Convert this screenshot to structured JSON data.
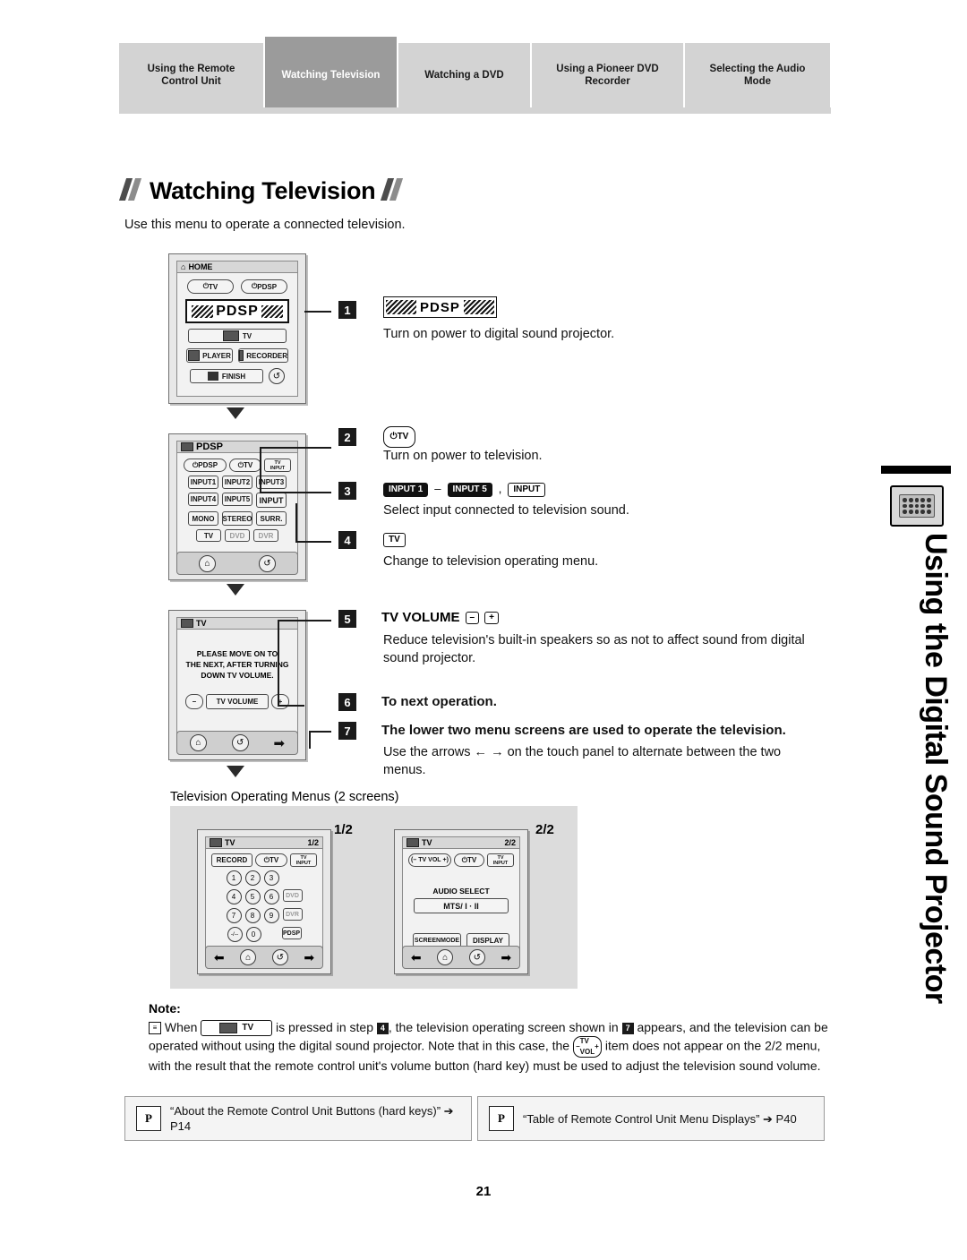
{
  "tabs": [
    {
      "label": "Using the Remote\nControl Unit",
      "line1": "Using the Remote",
      "line2": "Control Unit",
      "active": false
    },
    {
      "label": "Watching Television",
      "line1": "Watching Television",
      "line2": "",
      "active": true
    },
    {
      "label": "Watching a DVD",
      "line1": "Watching a DVD",
      "line2": "",
      "active": false
    },
    {
      "label": "Using a Pioneer DVD Recorder",
      "line1": "Using a Pioneer DVD",
      "line2": "Recorder",
      "active": false
    },
    {
      "label": "Selecting the Audio Mode",
      "line1": "Selecting the Audio",
      "line2": "Mode",
      "active": false
    }
  ],
  "heading": "Watching Television",
  "subheading": "Use this menu to operate a connected television.",
  "side_title": "Using the Digital Sound Projector",
  "steps": [
    {
      "num": "1",
      "key": "PDSP",
      "text": "Turn on power to digital sound projector."
    },
    {
      "num": "2",
      "key": "TV",
      "text": "Turn on power to television."
    },
    {
      "num": "3",
      "key": "INPUT 1 – INPUT 5 , INPUT",
      "text": "Select input connected to television sound."
    },
    {
      "num": "4",
      "key": "TV",
      "text": "Change to television operating menu."
    },
    {
      "num": "5",
      "key": "TV VOLUME",
      "title": "TV VOLUME",
      "text": "Reduce television's built-in speakers so as not to affect sound from digital sound projector."
    },
    {
      "num": "6",
      "title": "To next operation.",
      "text": ""
    },
    {
      "num": "7",
      "title": "The lower two menu screens are used to operate the television.",
      "text": "Use the arrows ← → on the touch panel to alternate between the two menus."
    }
  ],
  "menus_caption": "Television Operating Menus (2 screens)",
  "screen_labels": {
    "left": "1/2",
    "right": "2/2"
  },
  "remote1": {
    "header": "HOME",
    "row1": [
      "TV",
      "PDSP"
    ],
    "pdsp_label": "PDSP",
    "tv_label": "TV",
    "player": "PLAYER",
    "recorder": "RECORDER",
    "finish": "FINISH"
  },
  "remote2": {
    "header": "PDSP",
    "row1": [
      "PDSP",
      "TV",
      "TV INPUT"
    ],
    "inputs": [
      "INPUT1",
      "INPUT2",
      "INPUT3",
      "INPUT4",
      "INPUT5",
      "INPUT"
    ],
    "modes": [
      "MONO",
      "STEREO",
      "SURR."
    ],
    "sources": [
      "TV",
      "DVD",
      "DVR"
    ]
  },
  "remote3": {
    "header": "TV",
    "message": [
      "PLEASE MOVE ON TO",
      "THE NEXT, AFTER TURNING",
      "DOWN TV VOLUME."
    ],
    "volume": "TV VOLUME",
    "minus": "–",
    "plus": "+"
  },
  "remote_left": {
    "header": "TV",
    "page": "1/2",
    "record": "RECORD",
    "tv": "TV",
    "tvinput": "TV INPUT",
    "keys": [
      "1",
      "2",
      "3",
      "4",
      "5",
      "6",
      "7",
      "8",
      "9",
      "-/--",
      "0"
    ],
    "side": [
      "DVD",
      "DVR",
      "PDSP"
    ]
  },
  "remote_right": {
    "header": "TV",
    "page": "2/2",
    "tvvol": "TV VOL",
    "tv": "TV",
    "tvinput": "TV INPUT",
    "audio_select": "AUDIO SELECT",
    "mts": "MTS/ I · II",
    "screenmode": "SCREENMODE",
    "display": "DISPLAY"
  },
  "note": {
    "title": "Note:",
    "text_parts": {
      "p1": "When",
      "key1": "TV",
      "p2": "is pressed in step",
      "step1": "4",
      "p3": ", the television operating screen shown in",
      "step2": "7",
      "p4": "appears, and the television can be operated without using the digital sound projector. Note that in this case, the",
      "key2": "TV VOL",
      "p5": "item does not appear on the 2/2 menu, with the result that the remote control unit's volume button (hard key) must be used to adjust the television sound volume."
    }
  },
  "references": [
    {
      "icon": "P",
      "text": "“About the Remote Control Unit Buttons (hard keys)” ➔ P14"
    },
    {
      "icon": "P",
      "text": "“Table of Remote Control Unit Menu Displays” ➔ P40"
    }
  ],
  "page_number": "21"
}
